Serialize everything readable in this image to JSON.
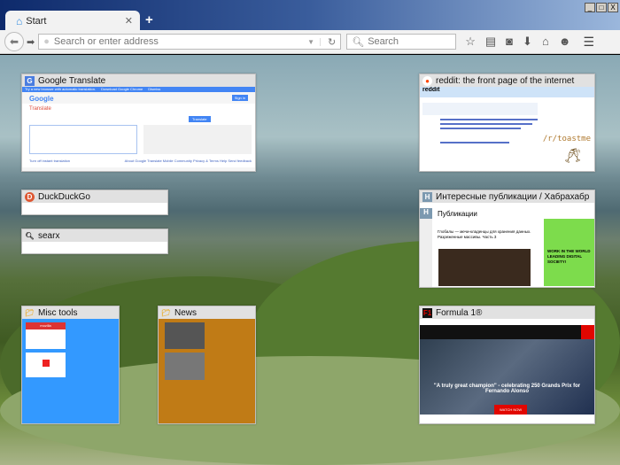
{
  "window": {
    "buttons": [
      "_",
      "□",
      "X"
    ]
  },
  "tab": {
    "label": "Start",
    "new_tab": "+"
  },
  "toolbar": {
    "url_placeholder": "Search or enter address",
    "search_placeholder": "Search"
  },
  "tiles": {
    "google_translate": {
      "title": "Google Translate",
      "banner": "Try a new browser with automatic translation.",
      "banner_btn": "Download Google Chrome",
      "banner_btn2": "Dismiss",
      "logo": "Google",
      "sign_in": "Sign in",
      "heading": "Translate",
      "translate_btn": "Translate",
      "footer_left": "Turn off instant translation",
      "footer_right": "About Google Translate   Mobile   Community   Privacy & Terms   Help   Send feedback"
    },
    "duckduckgo": {
      "title": "DuckDuckGo"
    },
    "searx": {
      "title": "searx"
    },
    "reddit": {
      "title": "reddit: the front page of the internet",
      "logo": "reddit",
      "sidebar_text": "/r/toastme"
    },
    "habr": {
      "title": "Интересные публикации / Хабрахабр",
      "heading": "Публикации",
      "article": "Глобалы — мечи-кладенцы для хранения данных. Разреженные массивы. Часть 3",
      "ad": "WORK IN THE WORLD LEADING DIGITAL SOCIETY!"
    },
    "misc": {
      "title": "Misc tools",
      "thumb1": "mozilla"
    },
    "news": {
      "title": "News"
    },
    "f1": {
      "title": "Formula 1®",
      "headline": "\"A truly great champion\" - celebrating 250 Grands Prix for Fernando Alonso",
      "cta": "WATCH NOW"
    }
  }
}
